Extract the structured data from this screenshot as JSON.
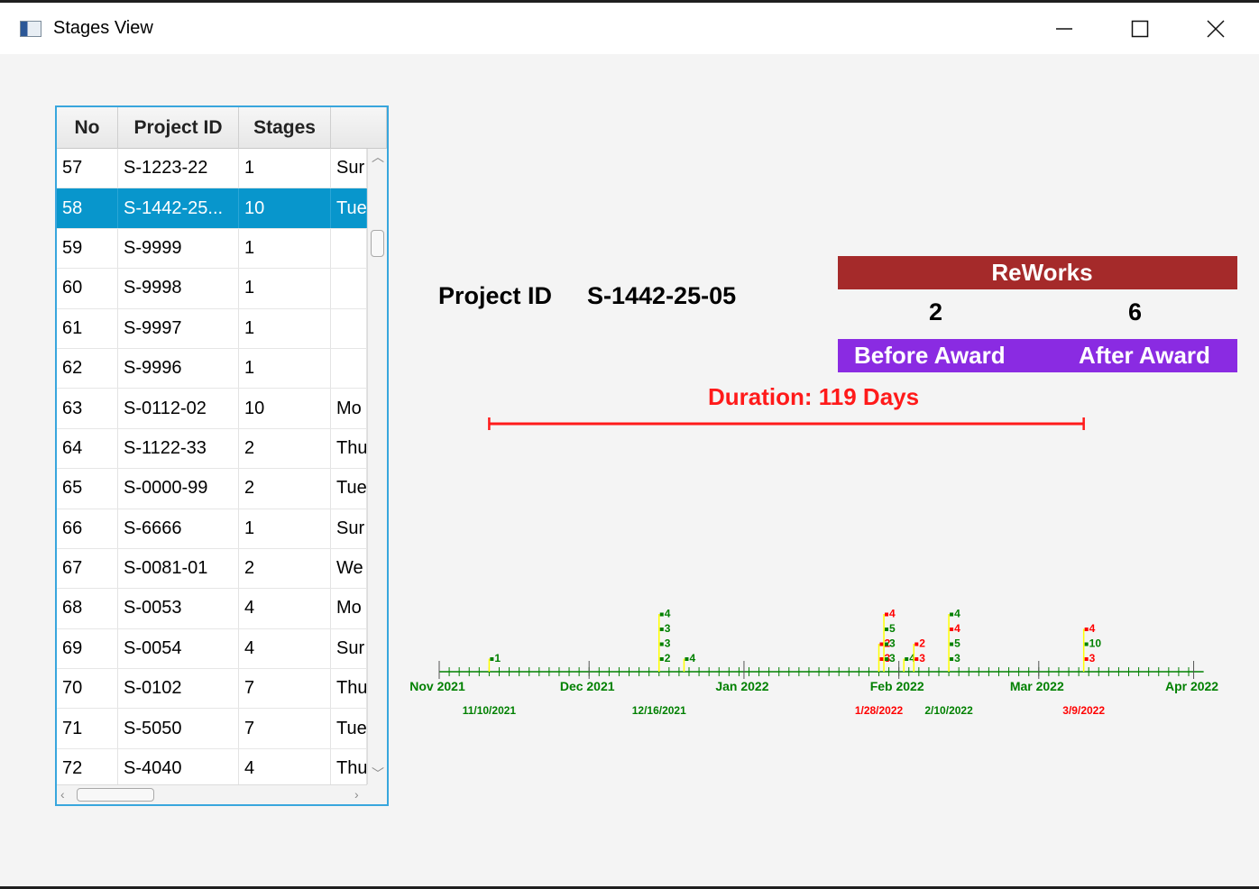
{
  "window": {
    "title": "Stages View"
  },
  "table": {
    "columns": [
      "No",
      "Project ID",
      "Stages",
      ""
    ],
    "rows": [
      [
        "57",
        "S-1223-22",
        "1",
        "Sur"
      ],
      [
        "58",
        "S-1442-25...",
        "10",
        "Tue"
      ],
      [
        "59",
        "S-9999",
        "1",
        ""
      ],
      [
        "60",
        "S-9998",
        "1",
        ""
      ],
      [
        "61",
        "S-9997",
        "1",
        ""
      ],
      [
        "62",
        "S-9996",
        "1",
        ""
      ],
      [
        "63",
        "S-0112-02",
        "10",
        "Mo"
      ],
      [
        "64",
        "S-1122-33",
        "2",
        "Thu"
      ],
      [
        "65",
        "S-0000-99",
        "2",
        "Tue"
      ],
      [
        "66",
        "S-6666",
        "1",
        "Sur"
      ],
      [
        "67",
        "S-0081-01",
        "2",
        "We"
      ],
      [
        "68",
        "S-0053",
        "4",
        "Mo"
      ],
      [
        "69",
        "S-0054",
        "4",
        "Sur"
      ],
      [
        "70",
        "S-0102",
        "7",
        "Thu"
      ],
      [
        "71",
        "S-5050",
        "7",
        "Tue"
      ],
      [
        "72",
        "S-4040",
        "4",
        "Thu"
      ]
    ],
    "selected_index": 1
  },
  "project": {
    "label": "Project ID",
    "value": "S-1442-25-05"
  },
  "reworks": {
    "title": "ReWorks",
    "before_count": "2",
    "after_count": "6",
    "before_label": "Before Award",
    "after_label": "After Award"
  },
  "duration": {
    "text": "Duration: 119 Days"
  },
  "colors": {
    "reworks_bar": "#a52a2a",
    "award_bar": "#8a2be2",
    "duration": "#ff1a1a",
    "green": "#008000",
    "red": "#ff0000",
    "stem": "#ffff00",
    "selection": "#0896cc"
  },
  "timeline": {
    "month_labels": [
      "Nov 2021",
      "Dec 2021",
      "Jan 2022",
      "Feb 2022",
      "Mar 2022",
      "Apr 2022"
    ],
    "date_labels": [
      {
        "text": "11/10/2021",
        "color": "green"
      },
      {
        "text": "12/16/2021",
        "color": "green"
      },
      {
        "text": "1/28/2022",
        "color": "red"
      },
      {
        "text": "2/10/2022",
        "color": "green"
      },
      {
        "text": "3/9/2022",
        "color": "red"
      }
    ],
    "events": [
      {
        "day": 10,
        "markers": [
          {
            "label": "1",
            "color": "green"
          }
        ]
      },
      {
        "day": 44,
        "markers": [
          {
            "label": "2",
            "color": "green"
          },
          {
            "label": "3",
            "color": "green"
          },
          {
            "label": "3",
            "color": "green"
          },
          {
            "label": "4",
            "color": "green"
          }
        ]
      },
      {
        "day": 49,
        "markers": [
          {
            "label": "4",
            "color": "green"
          }
        ]
      },
      {
        "day": 88,
        "markers": [
          {
            "label": "3",
            "color": "red"
          },
          {
            "label": "2",
            "color": "red"
          }
        ]
      },
      {
        "day": 89,
        "markers": [
          {
            "label": "3",
            "color": "green"
          },
          {
            "label": "3",
            "color": "green"
          },
          {
            "label": "5",
            "color": "green"
          },
          {
            "label": "4",
            "color": "red"
          }
        ]
      },
      {
        "day": 93,
        "markers": [
          {
            "label": "4",
            "color": "green"
          }
        ]
      },
      {
        "day": 95,
        "markers": [
          {
            "label": "3",
            "color": "red"
          },
          {
            "label": "2",
            "color": "red"
          }
        ]
      },
      {
        "day": 102,
        "markers": [
          {
            "label": "3",
            "color": "green"
          },
          {
            "label": "5",
            "color": "green"
          },
          {
            "label": "4",
            "color": "red"
          },
          {
            "label": "4",
            "color": "green"
          }
        ]
      },
      {
        "day": 129,
        "markers": [
          {
            "label": "3",
            "color": "red"
          },
          {
            "label": "10",
            "color": "green"
          },
          {
            "label": "4",
            "color": "red"
          }
        ]
      }
    ]
  }
}
